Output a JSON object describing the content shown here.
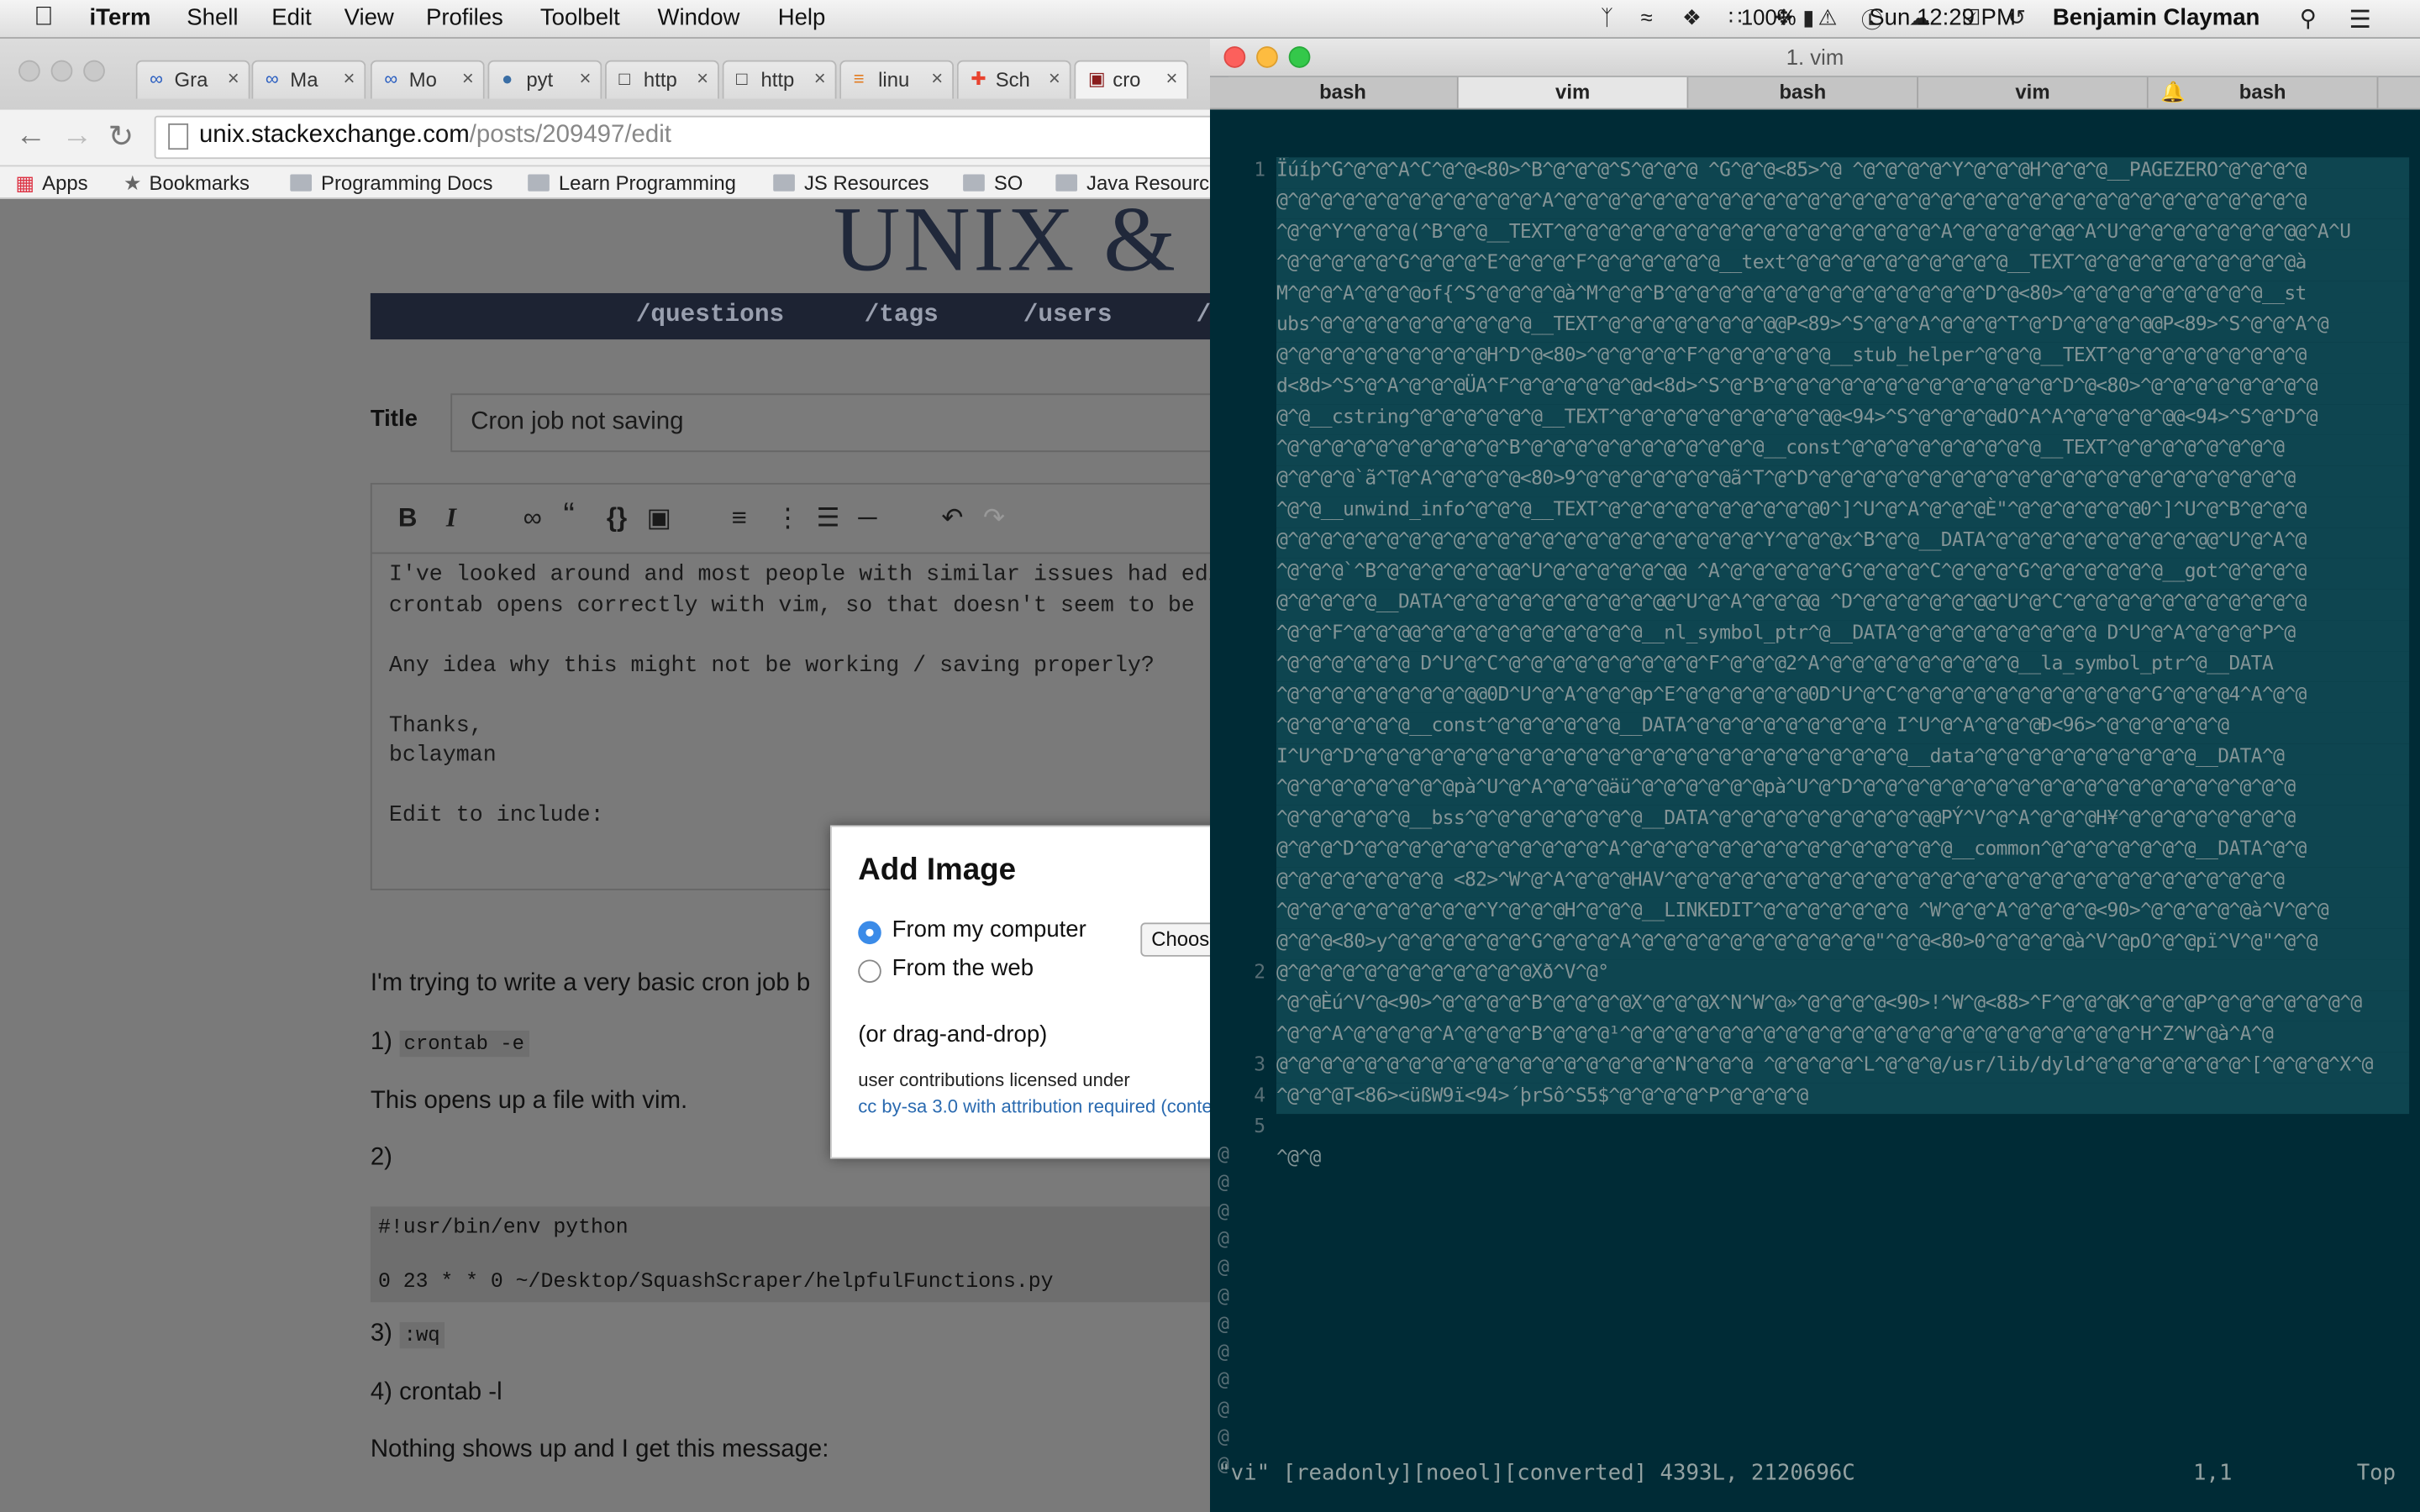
{
  "menubar": {
    "app": "iTerm",
    "items": [
      "Shell",
      "Edit",
      "View",
      "Profiles",
      "Toolbelt",
      "Window",
      "Help"
    ],
    "battery": "100%",
    "clock": "Sun 12:29 PM",
    "user": "Benjamin Clayman"
  },
  "browser": {
    "tabs": [
      "Gra",
      "Ma",
      "Mo",
      "pyt",
      "http",
      "http",
      "linu",
      "Sch",
      "cro"
    ],
    "url_domain": "unix.stackexchange.com",
    "url_path": "/posts/209497/edit",
    "bookmarks": [
      "Apps",
      "Bookmarks",
      "Programming Docs",
      "Learn Programming",
      "JS Resources",
      "SO",
      "Java Resourc"
    ],
    "site_logo": "UNIX &",
    "site_nav": [
      "/questions",
      "/tags",
      "/users",
      "/"
    ],
    "title_label": "Title",
    "title_value": "Cron job not saving",
    "editor_text": "I've looked around and most people with similar issues had edito\ncrontab opens correctly with vim, so that doesn't seem to be the\n\nAny idea why this might not be working / saving properly?\n\nThanks,\nbclayman\n\nEdit to include:",
    "body": {
      "intro": "I'm trying to write a very basic cron job b",
      "step1_num": "1)",
      "step1_code": "crontab -e",
      "opens": "This opens up a file with vim.",
      "step2": "2)",
      "code_line1": "#!usr/bin/env python",
      "code_line2": "0 23 * * 0 ~/Desktop/SquashScraper/helpfulFunctions.py",
      "step3_num": "3)",
      "step3_code": ":wq",
      "step4": "4) crontab -l",
      "nothing": "Nothing shows up and I get this message:"
    },
    "modal": {
      "title": "Add Image",
      "option1": "From my computer",
      "option2": "From the web",
      "choose": "Choos",
      "drag": "(or drag-and-drop)",
      "license1": "user contributions licensed under",
      "license2": "cc by-sa 3.0 with attribution required (conte"
    }
  },
  "iterm": {
    "window_title": "1. vim",
    "tabs": [
      "bash",
      "vim",
      "bash",
      "vim",
      "bash"
    ],
    "line_numbers": [
      "1",
      "2",
      "3",
      "4",
      "5"
    ],
    "lines": [
      "Ïúíþ^G^@^@^A^C^@^@<80>^B^@^@^@^S^@^@^@ ^G^@^@<85>^@ ^@^@^@^@^Y^@^@^@H^@^@^@__PAGEZERO^@^@^@^@",
      "@^@^@^@^@^@^@^@^@^@^@^@^A^@^@^@^@^@^@^@^@^@^@^@^@^@^@^@^@^@^@^@^@^@^@^@^@^@^@^@^@^@^@^@^@^@^@",
      "^@^@^Y^@^@^@(^B^@^@__TEXT^@^@^@^@^@^@^@^@^@^@^@^@^@^@^@^@^@^A^@^@^@^@^@@^A^U^@^@^@^@^@^@^@^@@^A^U",
      "^@^@^@^@^@^G^@^@^@^E^@^@^@^F^@^@^@^@^@^@__text^@^@^@^@^@^@^@^@^@^@__TEXT^@^@^@^@^@^@^@^@^@^@à",
      "M^@^@^A^@^@^@of{^S^@^@^@^@à^M^@^@^B^@^@^@^@^@^@^@^@^@^@^@^@^@^@^D^@<80>^@^@^@^@^@^@^@^@^@__st",
      "ubs^@^@^@^@^@^@^@^@^@^@__TEXT^@^@^@^@^@^@^@^@@P<89>^S^@^@^A^@^@^@^T^@^D^@^@^@^@@P<89>^S^@^@^A^@",
      "@^@^@^@^@^@^@^@^@^@H^D^@<80>^@^@^@^@^F^@^@^@^@^@^@__stub_helper^@^@^@__TEXT^@^@^@^@^@^@^@^@^@",
      "d<8d>^S^@^A^@^@^@ÜA^F^@^@^@^@^@^@d<8d>^S^@^B^@^@^@^@^@^@^@^@^@^@^@^@^@^D^@<80>^@^@^@^@^@^@^@^@",
      "@^@__cstring^@^@^@^@^@^@__TEXT^@^@^@^@^@^@^@^@^@^@@<94>^S^@^@^@^@dO^A^A^@^@^@^@^@@<94>^S^@^D^@",
      "^@^@^@^@^@^@^@^@^@^@^B^@^@^@^@^@^@^@^@^@^@^@__const^@^@^@^@^@^@^@^@^@__TEXT^@^@^@^@^@^@^@^@",
      "@^@^@^@`ã^T@^A^@^@^@^@<80>9^@^@^@^@^@^@^@ã^T^@^D^@^@^@^@^@^@^@^@^@^@^@^@^@^@^@^@^@^@^@^@^@^@",
      "^@^@__unwind_info^@^@^@__TEXT^@^@^@^@^@^@^@^@^@^@0^]^U^@^A^@^@^@È\"^@^@^@^@^@^@0^]^U^@^B^@^@^@",
      "@^@^@^@^@^@^@^@^@^@^@^@^@^@^@^@^@^@^@^@^@^@^Y^@^@^@x^B^@^@__DATA^@^@^@^@^@^@^@^@^@^@@^U^@^A^@",
      "^@^@^@`^B^@^@^@^@^@^@@^U^@^@^@^@^@^@@ ^A^@^@^@^@^@^G^@^@^@^C^@^@^@^G^@^@^@^@^@^@__got^@^@^@^@",
      "@^@^@^@^@__DATA^@^@^@^@^@^@^@^@^@^@@^U^@^A^@^@^@@ ^D^@^@^@^@^@^@@^U^@^C^@^@^@^@^@^@^@^@^@^@^@",
      "^@^@^F^@^@^@@^@^@^@^@^@^@^@^@^@^@__nl_symbol_ptr^@__DATA^@^@^@^@^@^@^@^@^@ D^U^@^A^@^@^@^P^@",
      "^@^@^@^@^@^@ D^U^@^C^@^@^@^@^@^@^@^@^@^F^@^@^@2^A^@^@^@^@^@^@^@^@^@__la_symbol_ptr^@__DATA",
      "^@^@^@^@^@^@^@^@^@@0D^U^@^A^@^@^@p^E^@^@^@^@^@^@0D^U^@^C^@^@^@^@^@^@^@^@^@^@^@^G^@^@^@4^A^@^@",
      "^@^@^@^@^@^@__const^@^@^@^@^@^@__DATA^@^@^@^@^@^@^@^@^@ I^U^@^A^@^@^@Ð<96>^@^@^@^@^@^@",
      " I^U^@^D^@^@^@^@^@^@^@^@^@^@^@^@^@^@^@^@^@^@^@^@^@^@^@^@^@__data^@^@^@^@^@^@^@^@^@^@__DATA^@",
      "^@^@^@^@^@^@^@^@pà^U^@^A^@^@^@äü^@^@^@^@^@^@pà^U^@^D^@^@^@^@^@^@^@^@^@^@^@^@^@^@^@^@^@^@^@^@",
      "^@^@^@^@^@^@__bss^@^@^@^@^@^@^@^@__DATA^@^@^@^@^@^@^@^@^@^@@PÝ^V^@^A^@^@^@H¥^@^@^@^@^@^@^@^@",
      "@^@^@^D^@^@^@^@^@^@^@^@^@^@^@^A^@^@^@^@^@^@^@^@^@^@^@^@^@^@^@__common^@^@^@^@^@^@^@__DATA^@^@",
      "@^@^@^@^@^@^@^@ <82>^W^@^A^@^@^@HAV^@^@^@^@^@^@^@^@^@^@^@^@^@^@^@^@^@^@^@^@^@^@^@^@^@^@^@^@",
      "^@^@^@^@^@^@^@^@^@^Y^@^@^@H^@^@^@__LINKEDIT^@^@^@^@^@^@^@ ^W^@^@^A^@^@^@^@<90>^@^@^@^@^@à^V^@^@",
      "@^@^@<80>y^@^@^@^@^@^@^G^@^@^@^A^@^@^@^@^@^@^@^@^@^@^@\"^@^@<80>0^@^@^@^@à^V^@pO^@^@pï^V^@\"^@^@",
      "@^@^@^@^@^@^@^@^@^@^@^@Xð^V^@°",
      "^@^@Èú^V^@<90>^@^@^@^@^B^@^@^@^@X^@^@^@X^N^W^@»^@^@^@^@<90>!^W^@<88>^F^@^@^@K^@^@^@P^@^@^@^@^@^@^@",
      "^@^@^A^@^@^@^@^A^@^@^@^B^@^@^@¹^@^@^@^@^@^@^@^@^@^@^@^@^@^@^@^@^@^@^@^@^@^@^@^H^Z^W^@à^A^@",
      "@^@^@^@^@^@^@^@^@^@^@^@^@^@^@^@^@^@^N^@^@^@ ^@^@^@^@^L^@^@^@/usr/lib/dyld^@^@^@^@^@^@^@^[^@^@^@^X^@",
      "^@^@^@T<86><üßW9ï<94>´þrSô^S5$^@^@^@^@^P^@^@^@^@",
      "",
      "^@^@"
    ],
    "tilde_char": "@",
    "status_left": "\"vi\" [readonly][noeol][converted] 4393L, 2120696C",
    "status_pos": "1,1",
    "status_right": "Top"
  },
  "colors": {
    "vim_bg": "#002b36",
    "vim_line_bg": "#0e4550",
    "nav_bg": "#1d2333",
    "modal_link": "#2a6ab0",
    "radio_on": "#3b8be8"
  }
}
